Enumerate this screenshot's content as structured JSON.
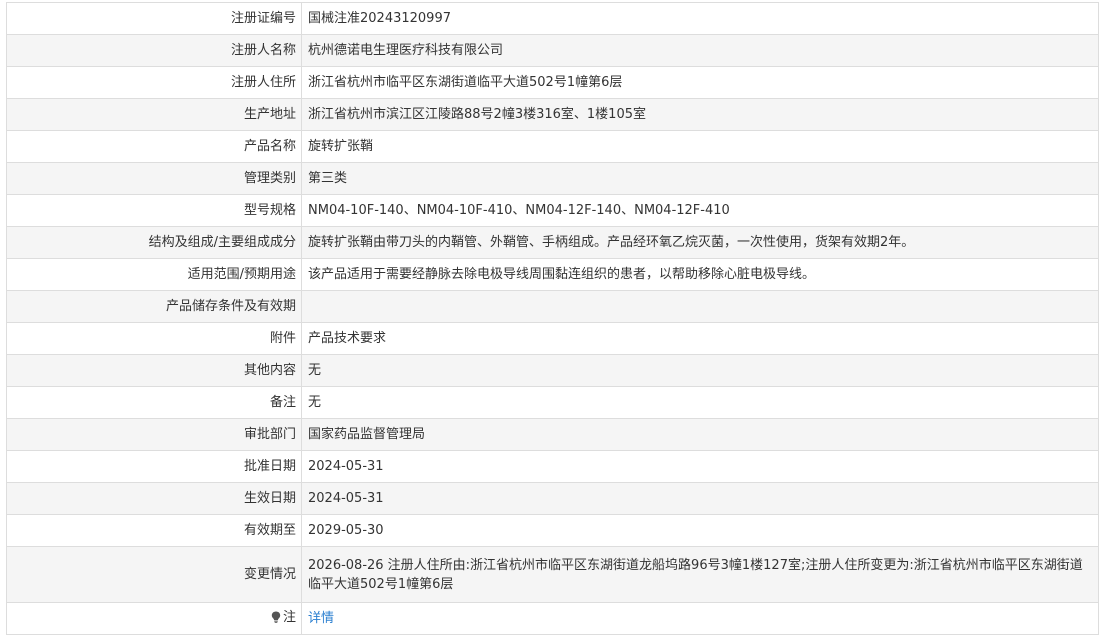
{
  "rows": [
    {
      "label": "注册证编号",
      "value": "国械注准20243120997"
    },
    {
      "label": "注册人名称",
      "value": "杭州德诺电生理医疗科技有限公司"
    },
    {
      "label": "注册人住所",
      "value": "浙江省杭州市临平区东湖街道临平大道502号1幢第6层"
    },
    {
      "label": "生产地址",
      "value": "浙江省杭州市滨江区江陵路88号2幢3楼316室、1楼105室"
    },
    {
      "label": "产品名称",
      "value": "旋转扩张鞘"
    },
    {
      "label": "管理类别",
      "value": "第三类"
    },
    {
      "label": "型号规格",
      "value": "NM04-10F-140、NM04-10F-410、NM04-12F-140、NM04-12F-410"
    },
    {
      "label": "结构及组成/主要组成成分",
      "value": "旋转扩张鞘由带刀头的内鞘管、外鞘管、手柄组成。产品经环氧乙烷灭菌，一次性使用，货架有效期2年。"
    },
    {
      "label": "适用范围/预期用途",
      "value": "该产品适用于需要经静脉去除电极导线周围黏连组织的患者，以帮助移除心脏电极导线。"
    },
    {
      "label": "产品储存条件及有效期",
      "value": ""
    },
    {
      "label": "附件",
      "value": "产品技术要求"
    },
    {
      "label": "其他内容",
      "value": "无"
    },
    {
      "label": "备注",
      "value": "无"
    },
    {
      "label": "审批部门",
      "value": "国家药品监督管理局"
    },
    {
      "label": "批准日期",
      "value": "2024-05-31"
    },
    {
      "label": "生效日期",
      "value": "2024-05-31"
    },
    {
      "label": "有效期至",
      "value": "2029-05-30"
    },
    {
      "label": "变更情况",
      "value": "2026-08-26 注册人住所由:浙江省杭州市临平区东湖街道龙船坞路96号3幢1楼127室;注册人住所变更为:浙江省杭州市临平区东湖街道临平大道502号1幢第6层"
    }
  ],
  "note": {
    "label": "注",
    "link_text": "详情",
    "icon": "lightbulb-icon"
  },
  "colors": {
    "border": "#dddddd",
    "stripe": "#f5f5f5",
    "link": "#2b7fd0",
    "text": "#333333"
  }
}
